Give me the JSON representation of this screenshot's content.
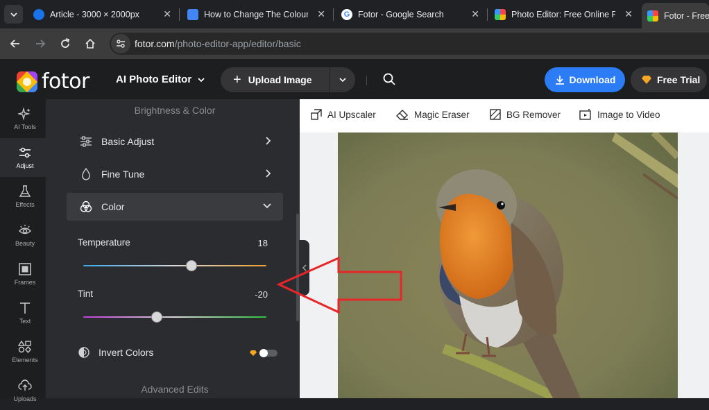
{
  "browser": {
    "tabs": [
      {
        "title": "Article - 3000 × 2000px",
        "favicon_color": "#1a73e8"
      },
      {
        "title": "How to Change The Colour o",
        "favicon_color": "#4285f4"
      },
      {
        "title": "Fotor - Google Search",
        "favicon_color": "#ffffff"
      },
      {
        "title": "Photo Editor: Free Online Ph",
        "favicon_color": "#f4b400"
      },
      {
        "title": "Fotor - Free",
        "favicon_color": "#f4b400"
      }
    ],
    "url_domain": "fotor.com",
    "url_path": "/photo-editor-app/editor/basic"
  },
  "header": {
    "logo_text": "fotor",
    "mode_label": "AI Photo Editor",
    "upload_label": "Upload Image",
    "download_label": "Download",
    "trial_label": "Free Trial",
    "accent_color": "#2c7cf6"
  },
  "rail": {
    "items": [
      {
        "label": "AI Tools",
        "icon": "sparkle-icon"
      },
      {
        "label": "Adjust",
        "icon": "sliders-icon"
      },
      {
        "label": "Effects",
        "icon": "flask-icon"
      },
      {
        "label": "Beauty",
        "icon": "eye-icon"
      },
      {
        "label": "Frames",
        "icon": "frame-icon"
      },
      {
        "label": "Text",
        "icon": "text-icon"
      },
      {
        "label": "Elements",
        "icon": "shapes-icon"
      },
      {
        "label": "Uploads",
        "icon": "cloud-upload-icon"
      }
    ],
    "active": "Adjust"
  },
  "panel": {
    "section_title": "Brightness & Color",
    "basic_adjust": "Basic Adjust",
    "fine_tune": "Fine Tune",
    "color": "Color",
    "temperature_label": "Temperature",
    "temperature_value": "18",
    "temperature_level": 0.59,
    "tint_label": "Tint",
    "tint_value": "-20",
    "tint_level": 0.4,
    "invert_label": "Invert Colors",
    "invert_on": false,
    "advanced_title": "Advanced Edits"
  },
  "canvas_tools": {
    "upscaler": "AI Upscaler",
    "eraser": "Magic Eraser",
    "bg_remover": "BG Remover",
    "image_to_video": "Image to Video"
  }
}
